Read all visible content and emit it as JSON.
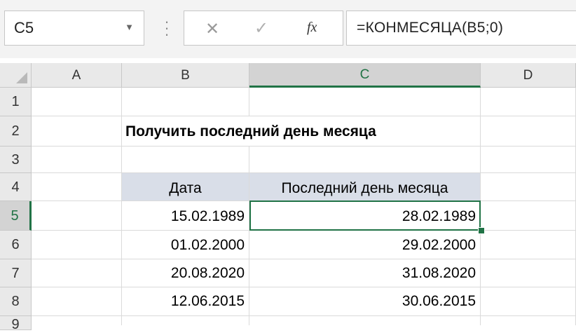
{
  "formula_bar": {
    "name_box": "C5",
    "cancel_glyph": "✕",
    "enter_glyph": "✓",
    "fx_label": "fx",
    "formula": "=КОНМЕСЯЦА(B5;0)"
  },
  "columns": [
    "A",
    "B",
    "C",
    "D"
  ],
  "rows": [
    "1",
    "2",
    "3",
    "4",
    "5",
    "6",
    "7",
    "8",
    "9"
  ],
  "selected_cell": "C5",
  "sheet": {
    "title": "Получить последний день месяца",
    "header_date": "Дата",
    "header_last_day": "Последний день месяца",
    "data": [
      {
        "date": "15.02.1989",
        "last_day": "28.02.1989"
      },
      {
        "date": "01.02.2000",
        "last_day": "29.02.2000"
      },
      {
        "date": "20.08.2020",
        "last_day": "31.08.2020"
      },
      {
        "date": "12.06.2015",
        "last_day": "30.06.2015"
      }
    ]
  },
  "colors": {
    "accent": "#217346",
    "header_fill": "#d9dee8",
    "grid_header": "#e9e9e9"
  },
  "icons": {
    "name_dropdown": "chevron-down-icon",
    "more": "vertical-dots-icon",
    "cancel": "close-icon",
    "enter": "checkmark-icon",
    "insert_function": "fx-icon"
  }
}
